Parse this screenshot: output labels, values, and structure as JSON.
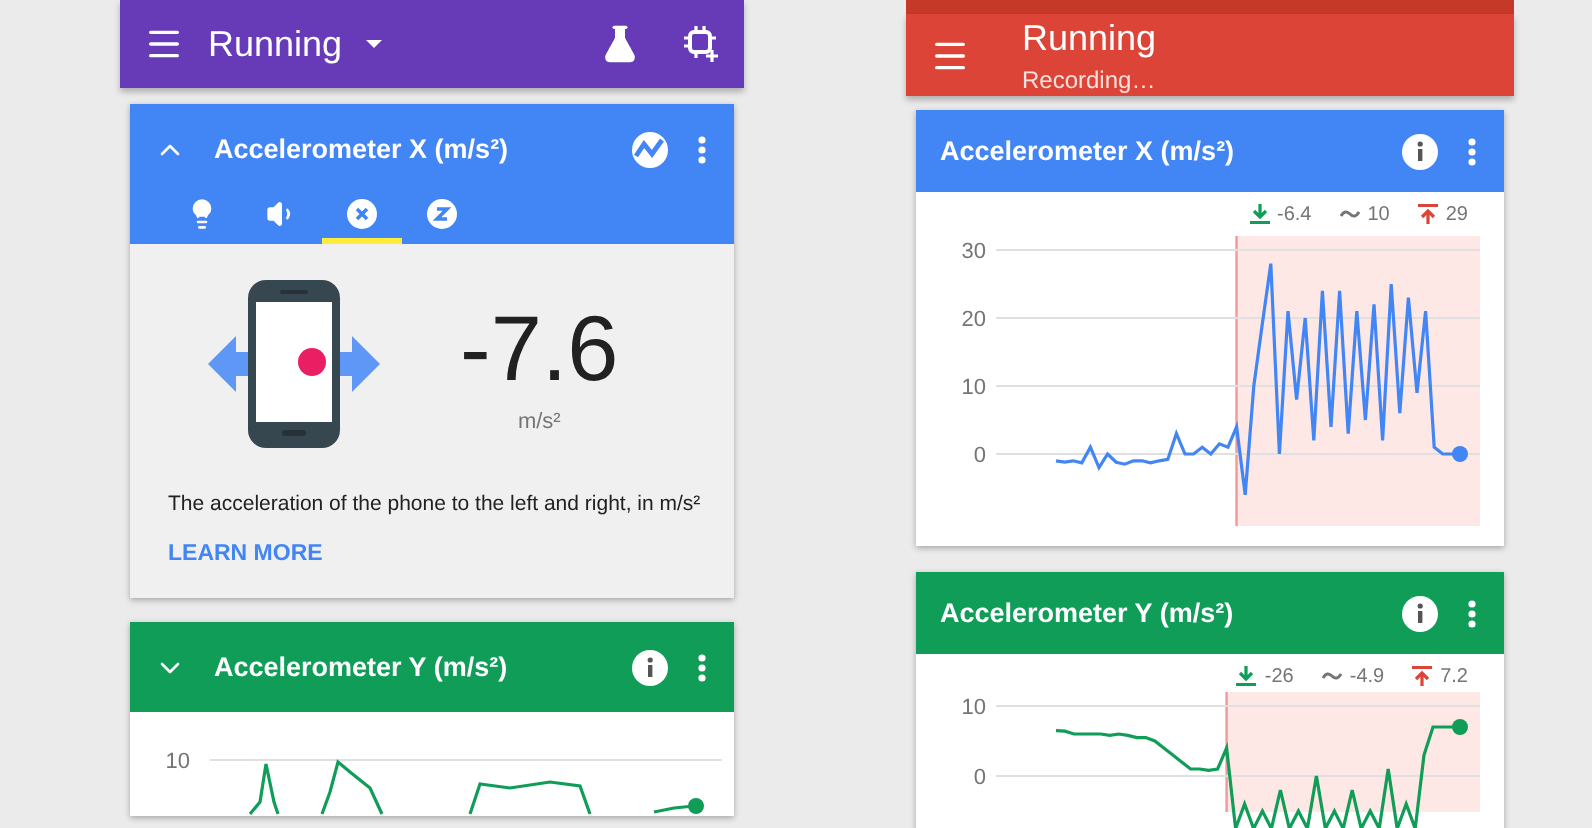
{
  "left_phone": {
    "app_bar": {
      "title": "Running"
    },
    "cards": [
      {
        "title": "Accelerometer X (m/s²)",
        "expanded": true,
        "color": "#4285f4",
        "sensor_tabs": [
          {
            "kind": "light",
            "selected": false
          },
          {
            "kind": "sound",
            "selected": false
          },
          {
            "kind": "x",
            "selected": true
          },
          {
            "kind": "z",
            "selected": false
          }
        ],
        "reading": {
          "value": "-7.6",
          "unit": "m/s²",
          "description": "The acceleration of the phone to the left and right, in m/s²",
          "link": "LEARN MORE"
        }
      },
      {
        "title": "Accelerometer Y (m/s²)",
        "expanded": false,
        "color": "#0f9d58",
        "graph": {
          "y_tick": "10"
        }
      }
    ]
  },
  "right_phone": {
    "app_bar": {
      "title": "Running",
      "subtitle": "Recording…"
    },
    "cards": [
      {
        "title": "Accelerometer X (m/s²)",
        "color": "#4285f4",
        "stats": [
          {
            "kind": "min",
            "value": "-6.4"
          },
          {
            "kind": "average",
            "value": "10"
          },
          {
            "kind": "max",
            "value": "29"
          }
        ],
        "y_ticks": [
          "30",
          "20",
          "10",
          "0"
        ]
      },
      {
        "title": "Accelerometer Y (m/s²)",
        "color": "#0f9d58",
        "stats": [
          {
            "kind": "min",
            "value": "-26"
          },
          {
            "kind": "average",
            "value": "-4.9"
          },
          {
            "kind": "max",
            "value": "7.2"
          }
        ],
        "y_ticks": [
          "10",
          "0"
        ]
      }
    ]
  }
}
